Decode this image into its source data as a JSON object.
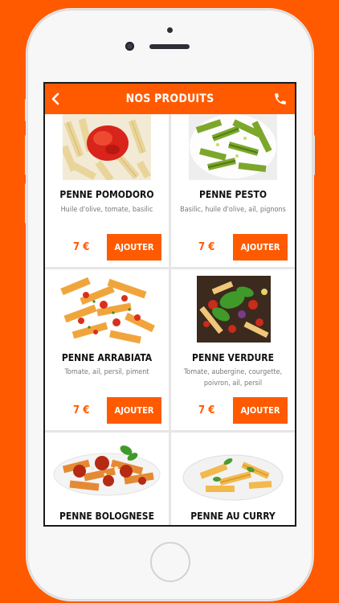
{
  "header": {
    "title": "NOS PRODUITS",
    "back_icon": "chevron-left-icon",
    "call_icon": "phone-icon"
  },
  "colors": {
    "accent": "#ff5a00",
    "card_background": "#ffffff",
    "grid_gap": "#e6e6e6",
    "name_text": "#111111",
    "description_text": "#777777"
  },
  "products": [
    {
      "name": "PENNE POMODORO",
      "description": "Huile d'olive, tomate, basilic",
      "price": "7 €",
      "button": "AJOUTER"
    },
    {
      "name": "PENNE PESTO",
      "description": "Basilic, huile d'olive, ail, pignons",
      "price": "7 €",
      "button": "AJOUTER"
    },
    {
      "name": "PENNE ARRABIATA",
      "description": "Tomate, ail, persil, piment",
      "price": "7 €",
      "button": "AJOUTER"
    },
    {
      "name": "PENNE VERDURE",
      "description": "Tomate, aubergine, courgette, poivron, ail, persil",
      "price": "7 €",
      "button": "AJOUTER"
    },
    {
      "name": "PENNE BOLOGNESE"
    },
    {
      "name": "PENNE AU CURRY"
    }
  ]
}
